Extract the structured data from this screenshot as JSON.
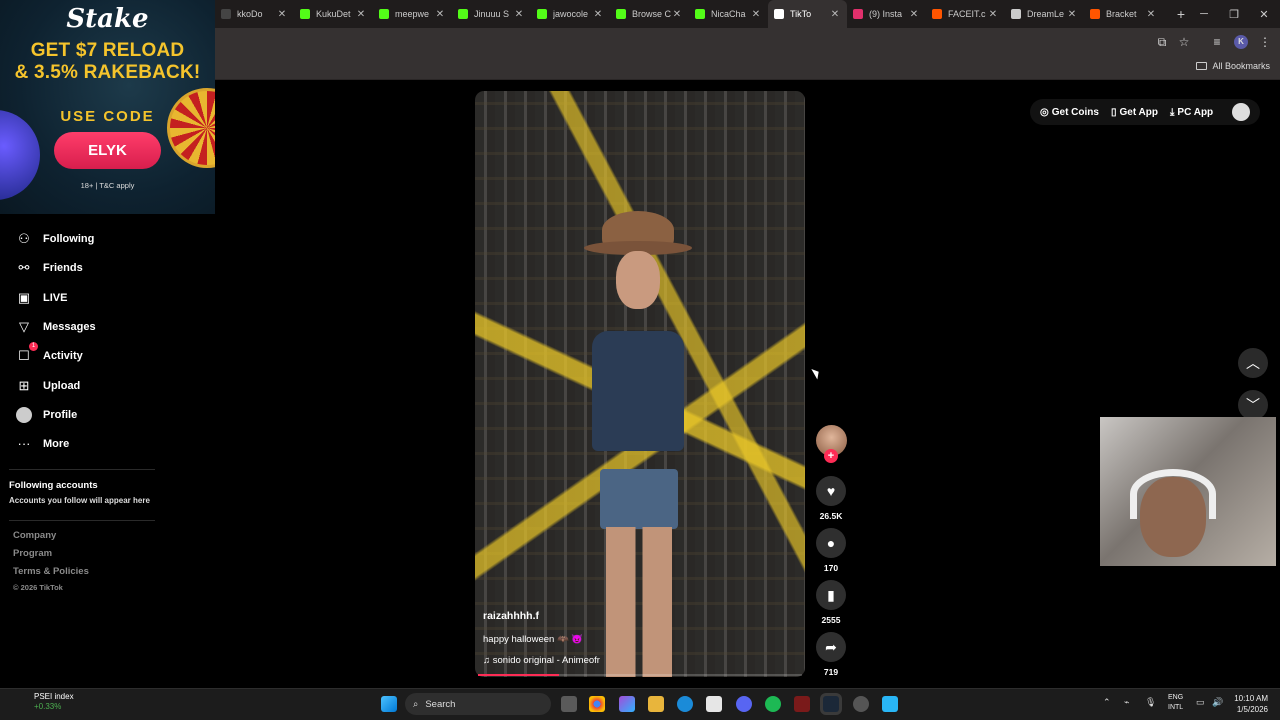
{
  "browser": {
    "tabs": [
      {
        "title": "kkoDo",
        "favicon": "dark-icon",
        "color": "#444444"
      },
      {
        "title": "KukuDet",
        "favicon": "kick-icon",
        "color": "#53fc18"
      },
      {
        "title": "meepwe",
        "favicon": "kick-icon",
        "color": "#53fc18"
      },
      {
        "title": "Jinuuu S",
        "favicon": "kick-icon",
        "color": "#53fc18"
      },
      {
        "title": "jawocole",
        "favicon": "kick-icon",
        "color": "#53fc18"
      },
      {
        "title": "Browse C",
        "favicon": "kick-icon",
        "color": "#53fc18"
      },
      {
        "title": "NicaCha",
        "favicon": "kick-icon",
        "color": "#53fc18"
      },
      {
        "title": "TikTo",
        "favicon": "tiktok-icon",
        "color": "#ffffff",
        "active": true
      },
      {
        "title": "(9) Insta",
        "favicon": "instagram-icon",
        "color": "#e1306c"
      },
      {
        "title": "FACEIT.c",
        "favicon": "faceit-icon",
        "color": "#ff5500"
      },
      {
        "title": "DreamLe",
        "favicon": "dreamleague-icon",
        "color": "#cccccc"
      },
      {
        "title": "Bracket",
        "favicon": "bracket-icon",
        "color": "#ff5500"
      }
    ],
    "new_tab": "+",
    "all_bookmarks": "All Bookmarks",
    "profile_initial": "K"
  },
  "ad": {
    "logo": "Stake",
    "headline_line1": "GET $7 RELOAD",
    "headline_line2": "& 3.5% RAKEBACK!",
    "use_code": "USE CODE",
    "code": "ELYK",
    "fine_print": "18+ | T&C apply"
  },
  "sidebar": {
    "items": [
      {
        "label": "Following",
        "icon": "following-icon",
        "glyph": "⚇"
      },
      {
        "label": "Friends",
        "icon": "friends-icon",
        "glyph": "⚯"
      },
      {
        "label": "LIVE",
        "icon": "live-icon",
        "glyph": "▣"
      },
      {
        "label": "Messages",
        "icon": "messages-icon",
        "glyph": "▽"
      },
      {
        "label": "Activity",
        "icon": "activity-icon",
        "glyph": "☐",
        "badge": "1"
      },
      {
        "label": "Upload",
        "icon": "upload-icon",
        "glyph": "⊞"
      },
      {
        "label": "Profile",
        "icon": "profile-avatar",
        "glyph": ""
      },
      {
        "label": "More",
        "icon": "more-icon",
        "glyph": "···"
      }
    ],
    "following_accounts_title": "Following accounts",
    "following_accounts_sub": "Accounts you follow will appear here",
    "footer": {
      "company": "Company",
      "program": "Program",
      "terms": "Terms & Policies",
      "copyright": "© 2026 TikTok"
    }
  },
  "header_actions": {
    "get_coins": "Get Coins",
    "get_app": "Get App",
    "pc_app": "PC App"
  },
  "video": {
    "username": "raizahhhh.f",
    "caption": "happy halloween 🦇 😈",
    "music": "sonido original - Animeofr",
    "progress": 0.25,
    "likes": "26.5K",
    "comments": "170",
    "saves": "2555",
    "shares": "719"
  },
  "taskbar": {
    "stock_name": "PSEI index",
    "stock_change": "+0.33%",
    "search_placeholder": "Search",
    "lang_line1": "ENG",
    "lang_line2": "INTL",
    "time": "10:10 AM",
    "date": "1/5/2026"
  }
}
